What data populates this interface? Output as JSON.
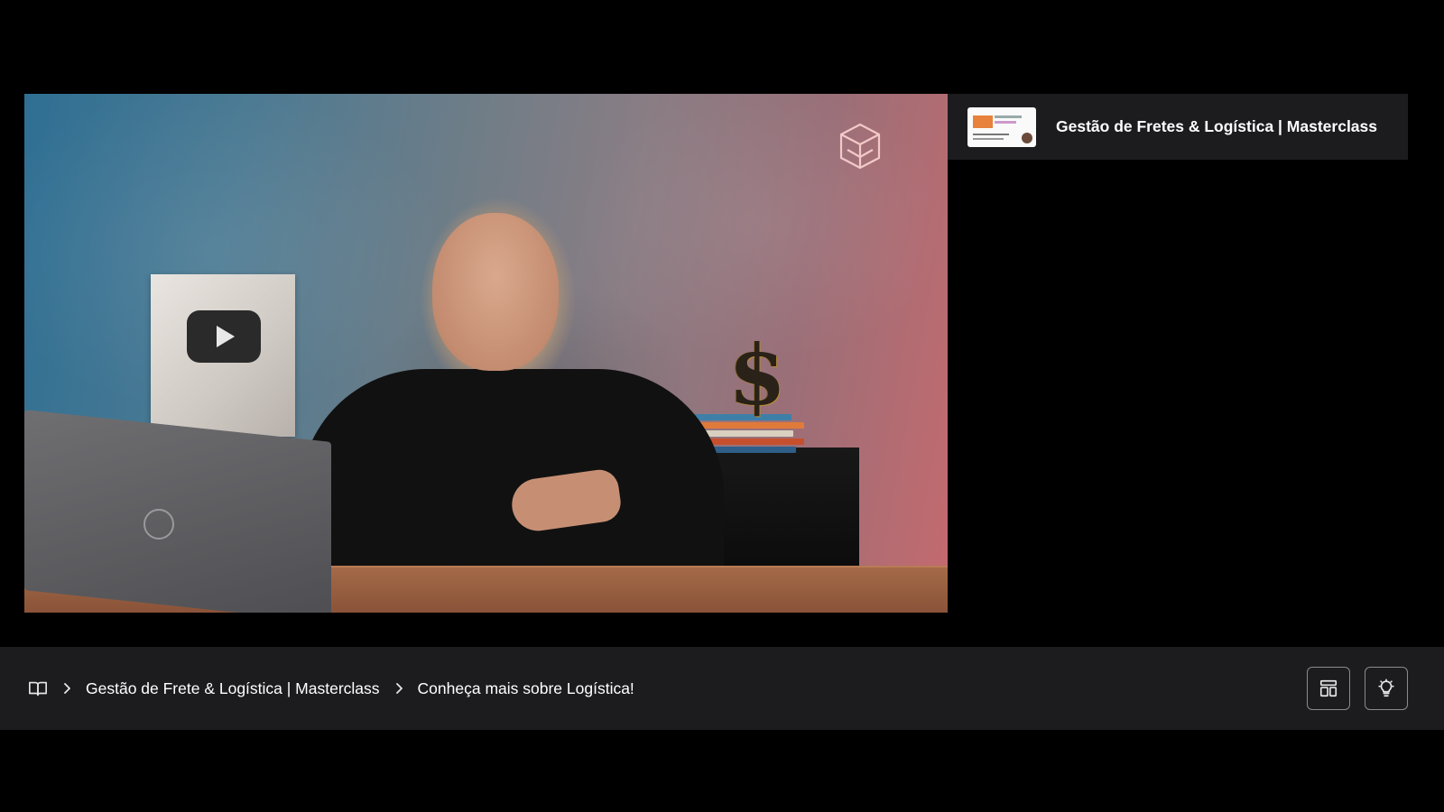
{
  "sidebar": {
    "course_title": "Gestão de Fretes & Logística | Masterclass",
    "thumbnail_icon": "course-thumbnail"
  },
  "breadcrumb": {
    "home_icon": "book-open-icon",
    "items": [
      {
        "label": "Gestão de Frete & Logística | Masterclass"
      },
      {
        "label": "Conheça mais sobre Logística!"
      }
    ]
  },
  "actions": [
    {
      "icon": "layout-icon"
    },
    {
      "icon": "lightbulb-icon"
    }
  ],
  "colors": {
    "background": "#000000",
    "panel": "#1c1c1f",
    "text": "#ffffff",
    "button_border": "#8a8a8f"
  }
}
